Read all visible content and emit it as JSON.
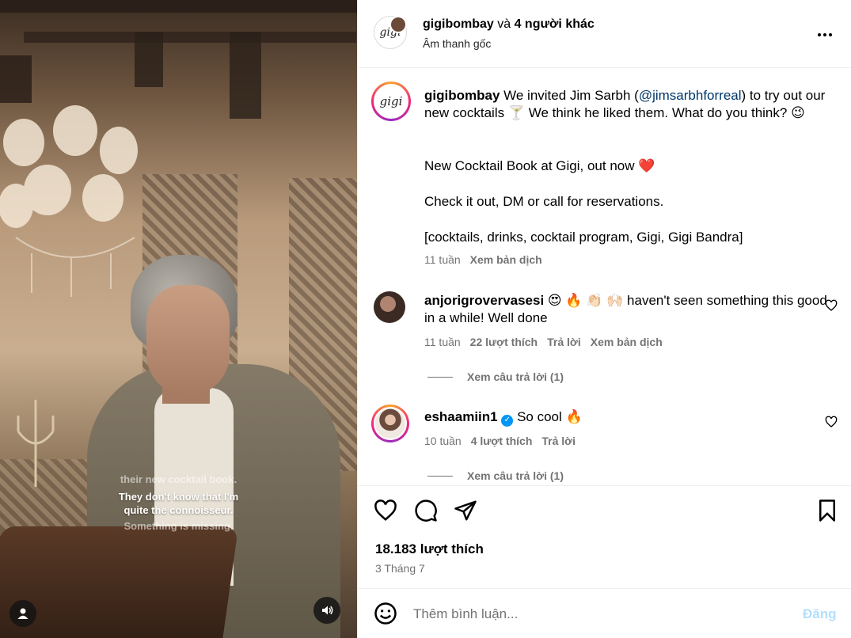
{
  "video": {
    "caption_faint_top": "their new cocktail book.",
    "caption_line_1": "They don't know that I'm",
    "caption_line_2": "quite the connoisseur.",
    "caption_faint_bottom": "Something is missing.",
    "user_icon": "user-silhouette-icon",
    "sound_icon": "speaker-icon"
  },
  "header": {
    "username": "gigibombay",
    "connector": " và ",
    "others": "4 người khác",
    "audio_label": "Âm thanh gốc",
    "logo_text": "gigi"
  },
  "caption_post": {
    "username": "gigibombay",
    "text_before_mention": " We invited Jim Sarbh (",
    "mention": "@jimsarbhforreal",
    "text_after_mention": ") to try out our new cocktails 🍸  We think he liked them. What do you think? 😉",
    "line_2": "New Cocktail Book at Gigi, out now ❤️",
    "line_3": "Check it out, DM or call for reservations.",
    "line_4": "[cocktails, drinks, cocktail program, Gigi, Gigi Bandra]",
    "time": "11 tuần",
    "translate": "Xem bản dịch"
  },
  "comments": [
    {
      "username": "anjorigrovervasesi",
      "text": " 😍 🔥 👏🏻 🙌🏻  haven't seen something this good in a while! Well done",
      "time": "11 tuần",
      "likes": "22 lượt thích",
      "reply": "Trả lời",
      "translate": "Xem bản dịch",
      "view_replies": "Xem câu trả lời (1)"
    },
    {
      "username": "eshaamiin1",
      "verified": "✓",
      "text": " So cool  🔥",
      "time": "10 tuần",
      "likes": "4 lượt thích",
      "reply": "Trả lời",
      "view_replies": "Xem câu trả lời (1)"
    }
  ],
  "stats": {
    "likes": "18.183 lượt thích",
    "date": "3 Tháng 7"
  },
  "comment_bar": {
    "placeholder": "Thêm bình luận...",
    "post_label": "Đăng"
  },
  "colors": {
    "link": "#00376b",
    "muted": "#737373",
    "post_disabled": "#b2dffc",
    "verified": "#0095f6"
  }
}
